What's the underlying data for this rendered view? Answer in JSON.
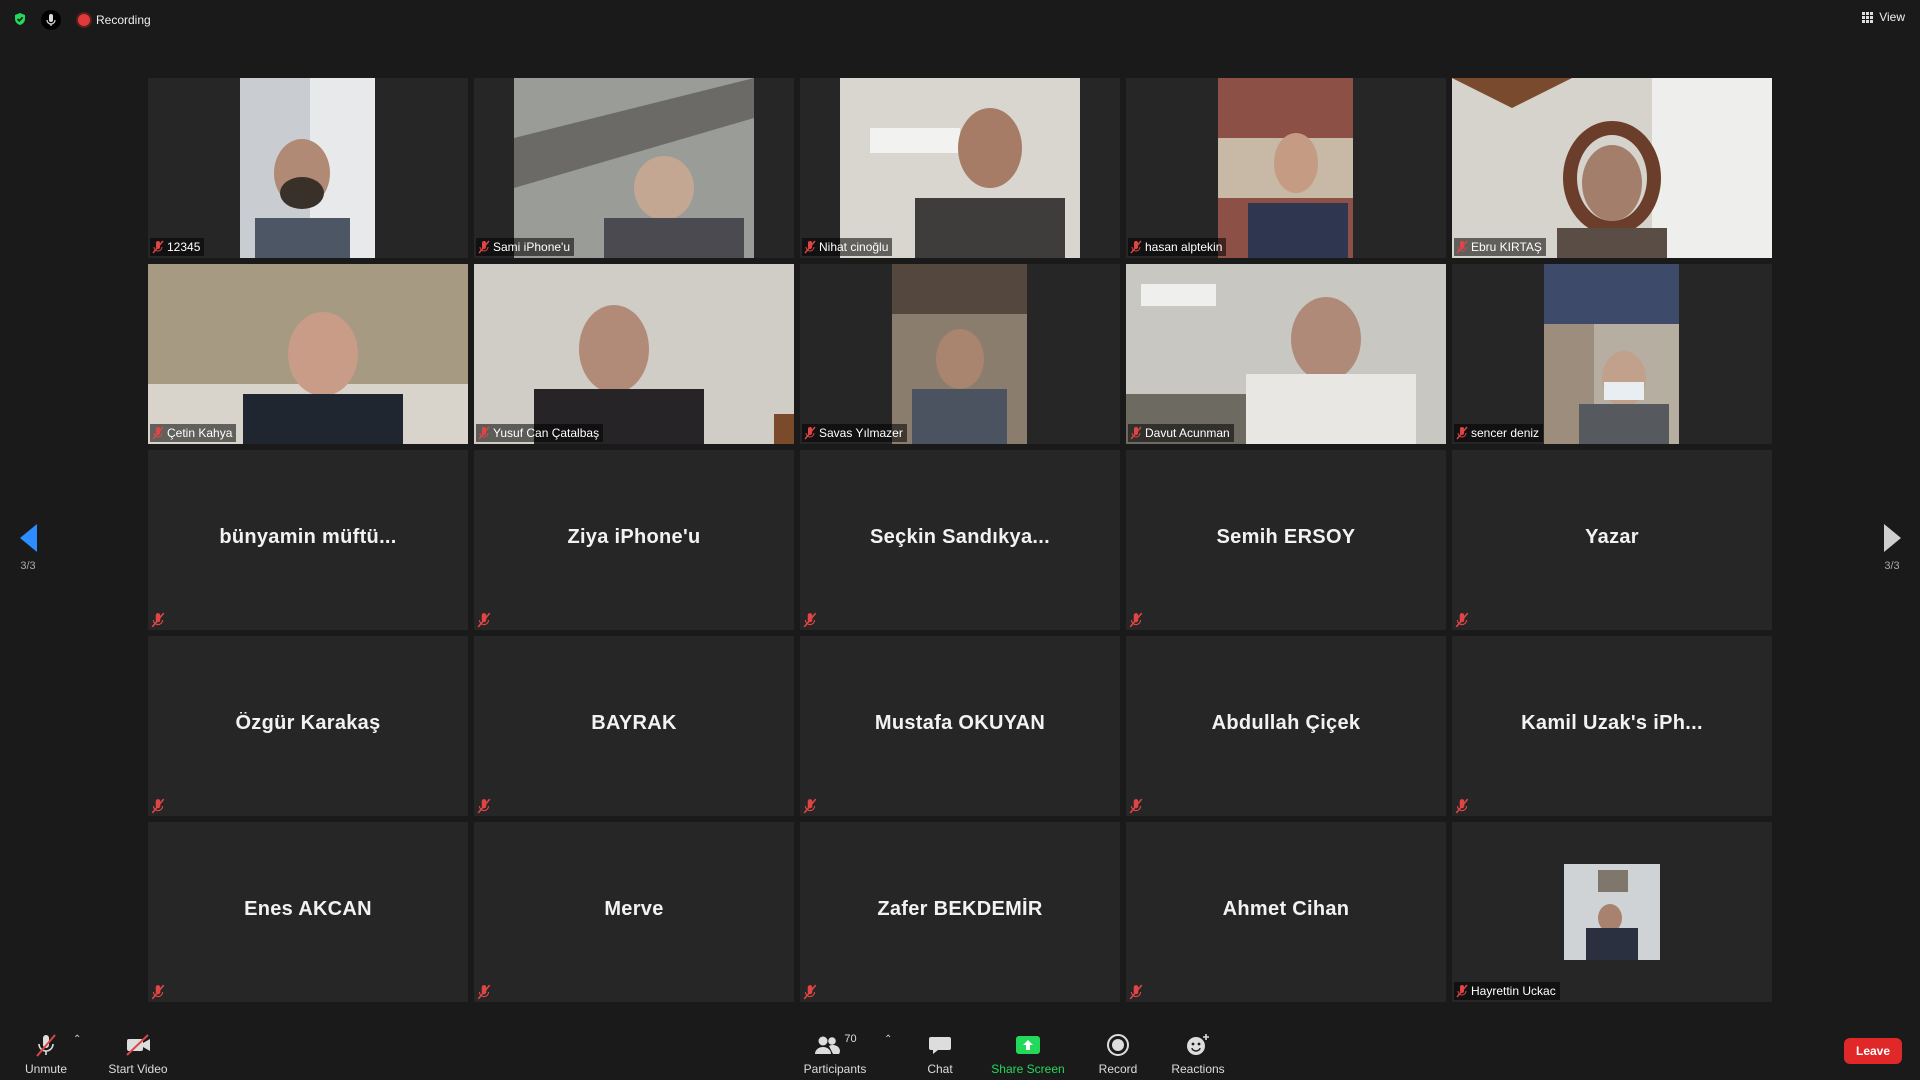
{
  "topbar": {
    "recording_label": "Recording",
    "view_label": "View"
  },
  "pager": {
    "left_label": "3/3",
    "right_label": "3/3"
  },
  "video_tiles": [
    {
      "name": "12345"
    },
    {
      "name": "Sami iPhone'u"
    },
    {
      "name": "Nihat cinoğlu"
    },
    {
      "name": "hasan alptekin"
    },
    {
      "name": "Ebru KIRTAŞ"
    },
    {
      "name": "Çetin Kahya"
    },
    {
      "name": "Yusuf Can Çatalbaş"
    },
    {
      "name": "Savas Yılmazer"
    },
    {
      "name": "Davut Acunman"
    },
    {
      "name": "sencer deniz"
    }
  ],
  "name_tiles": [
    {
      "name": "bünyamin  müftü..."
    },
    {
      "name": "Ziya iPhone'u"
    },
    {
      "name": "Seçkin  Sandıkya..."
    },
    {
      "name": "Semih ERSOY"
    },
    {
      "name": "Yazar"
    },
    {
      "name": "Özgür Karakaş"
    },
    {
      "name": "BAYRAK"
    },
    {
      "name": "Mustafa OKUYAN"
    },
    {
      "name": "Abdullah Çiçek"
    },
    {
      "name": "Kamil  Uzak's iPh..."
    },
    {
      "name": "Enes AKCAN"
    },
    {
      "name": "Merve"
    },
    {
      "name": "Zafer BEKDEMİR"
    },
    {
      "name": "Ahmet Cihan"
    }
  ],
  "last_tile": {
    "name": "Hayrettin Uckac"
  },
  "toolbar": {
    "unmute_label": "Unmute",
    "start_video_label": "Start Video",
    "participants_label": "Participants",
    "participants_count": "70",
    "chat_label": "Chat",
    "share_label": "Share Screen",
    "record_label": "Record",
    "reactions_label": "Reactions",
    "leave_label": "Leave"
  },
  "colors": {
    "background": "#1a1a1a",
    "tile": "#262626",
    "accent_blue": "#2d8cff",
    "share_green": "#23d959",
    "leave_red": "#e02828",
    "mute_red": "#e04545"
  }
}
